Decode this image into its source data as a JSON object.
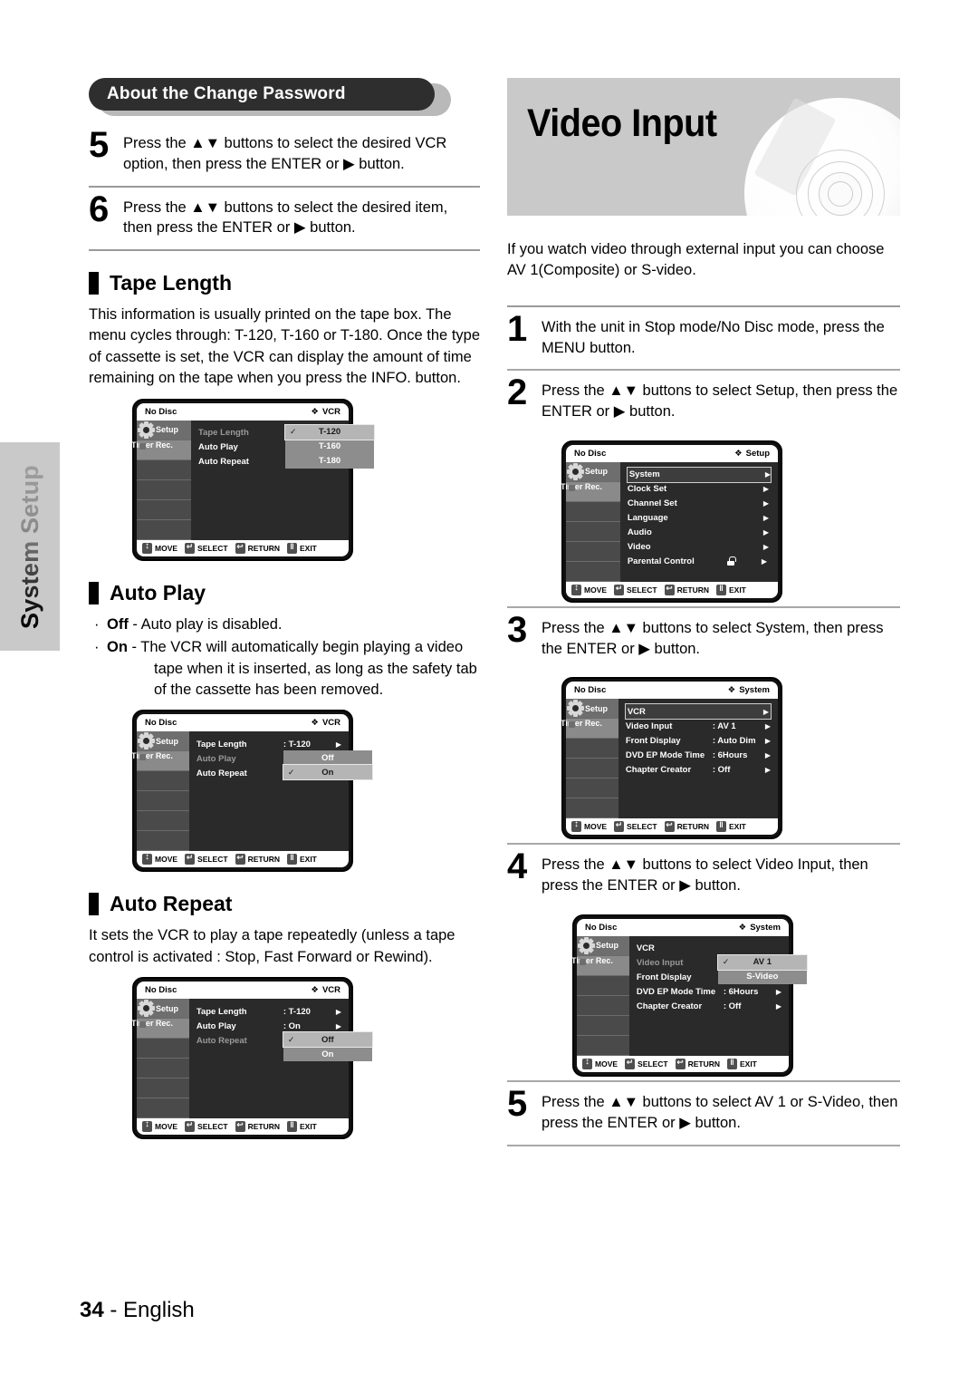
{
  "sidebar_tab": {
    "label": "System Setup"
  },
  "left_column": {
    "banner": {
      "title": "About the Change Password"
    },
    "steps": [
      {
        "num": "5",
        "text": "Press the ▲▼ buttons to select the desired VCR option, then press the ENTER or ▶ button."
      },
      {
        "num": "6",
        "text": "Press the ▲▼ buttons to select the desired item, then press the ENTER or ▶ button."
      }
    ],
    "sections": [
      {
        "heading": "Tape Length",
        "paragraph": "This information is usually printed on the tape box. The menu cycles through: T-120, T-160 or T-180. Once the type of cassette is set, the VCR can display the amount of time remaining on the tape when you press the INFO. button."
      },
      {
        "heading": "Auto Play",
        "bullets": [
          {
            "term": "Off",
            "text": " - Auto play is disabled."
          },
          {
            "term": "On",
            "text": " - The VCR will automatically begin playing a video tape when it is inserted, as long as the safety tab of the cassette has been removed."
          }
        ]
      },
      {
        "heading": "Auto Repeat",
        "paragraph": "It sets the VCR to play a tape repeatedly (unless a tape control is activated : Stop, Fast Forward or Rewind)."
      }
    ]
  },
  "right_column": {
    "title": "Video Input",
    "intro": "If you watch video through external input you can choose AV 1(Composite) or S-video.",
    "steps": [
      {
        "num": "1",
        "text": "With the unit in Stop mode/No Disc mode, press the MENU button."
      },
      {
        "num": "2",
        "text": "Press the ▲▼ buttons to select Setup, then press the ENTER or ▶ button."
      },
      {
        "num": "3",
        "text": "Press the ▲▼ buttons to select System, then press the ENTER or ▶ button."
      },
      {
        "num": "4",
        "text": "Press the ▲▼ buttons to select Video Input, then press the ENTER or ▶ button."
      },
      {
        "num": "5",
        "text": "Press the ▲▼ buttons to select AV 1 or S-Video, then press the ENTER or ▶ button."
      }
    ]
  },
  "osd_common": {
    "disc_status": "No Disc",
    "sidebar": {
      "setup": "Setup",
      "timer_rec": "Timer Rec."
    },
    "buttons": {
      "move": "MOVE",
      "select": "SELECT",
      "return": "RETURN",
      "exit": "EXIT"
    },
    "mode_icon": "❖"
  },
  "osd_screens": {
    "tape_length": {
      "mode": "VCR",
      "rows": [
        {
          "label": "Tape Length",
          "dim": true
        },
        {
          "label": "Auto Play",
          "dim": false
        },
        {
          "label": "Auto Repeat",
          "dim": false
        }
      ],
      "popup": {
        "items": [
          "T-120",
          "T-160",
          "T-180"
        ],
        "selected": "T-120"
      }
    },
    "auto_play": {
      "mode": "VCR",
      "rows": [
        {
          "label": "Tape Length",
          "value": ": T-120",
          "arrow": "▶",
          "dim": false
        },
        {
          "label": "Auto Play",
          "dim": true
        },
        {
          "label": "Auto Repeat",
          "dim": false
        }
      ],
      "popup": {
        "items": [
          "Off",
          "On"
        ],
        "selected": "On"
      }
    },
    "auto_repeat": {
      "mode": "VCR",
      "rows": [
        {
          "label": "Tape Length",
          "value": ": T-120",
          "arrow": "▶",
          "dim": false
        },
        {
          "label": "Auto Play",
          "value": ": On",
          "arrow": "▶",
          "dim": false
        },
        {
          "label": "Auto Repeat",
          "dim": true
        }
      ],
      "popup": {
        "items": [
          "Off",
          "On"
        ],
        "selected": "Off"
      }
    },
    "setup_menu": {
      "mode": "Setup",
      "rows": [
        {
          "label": "System",
          "arrow": "▶",
          "highlight": true
        },
        {
          "label": "Clock Set",
          "arrow": "▶"
        },
        {
          "label": "Channel Set",
          "arrow": "▶"
        },
        {
          "label": "Language",
          "arrow": "▶"
        },
        {
          "label": "Audio",
          "arrow": "▶"
        },
        {
          "label": "Video",
          "arrow": "▶"
        },
        {
          "label": "Parental Control",
          "arrow": "▶",
          "lock": true
        }
      ]
    },
    "system_menu": {
      "mode": "System",
      "rows": [
        {
          "label": "VCR",
          "arrow": "▶",
          "highlight": true
        },
        {
          "label": "Video Input",
          "value": ": AV 1",
          "arrow": "▶"
        },
        {
          "label": "Front Display",
          "value": ": Auto Dim",
          "arrow": "▶"
        },
        {
          "label": "DVD EP Mode Time",
          "value": ": 6Hours",
          "arrow": "▶"
        },
        {
          "label": "Chapter Creator",
          "value": ": Off",
          "arrow": "▶"
        }
      ]
    },
    "video_input_menu": {
      "mode": "System",
      "rows": [
        {
          "label": "VCR",
          "dim": false
        },
        {
          "label": "Video Input",
          "dim": true
        },
        {
          "label": "Front Display",
          "dim": false
        },
        {
          "label": "DVD EP Mode Time",
          "value": ": 6Hours",
          "arrow": "▶"
        },
        {
          "label": "Chapter Creator",
          "value": ": Off",
          "arrow": "▶"
        }
      ],
      "popup": {
        "items": [
          "AV 1",
          "S-Video"
        ],
        "selected": "AV 1"
      }
    }
  },
  "footer": {
    "page": "34",
    "dash": " - ",
    "language": "English"
  }
}
